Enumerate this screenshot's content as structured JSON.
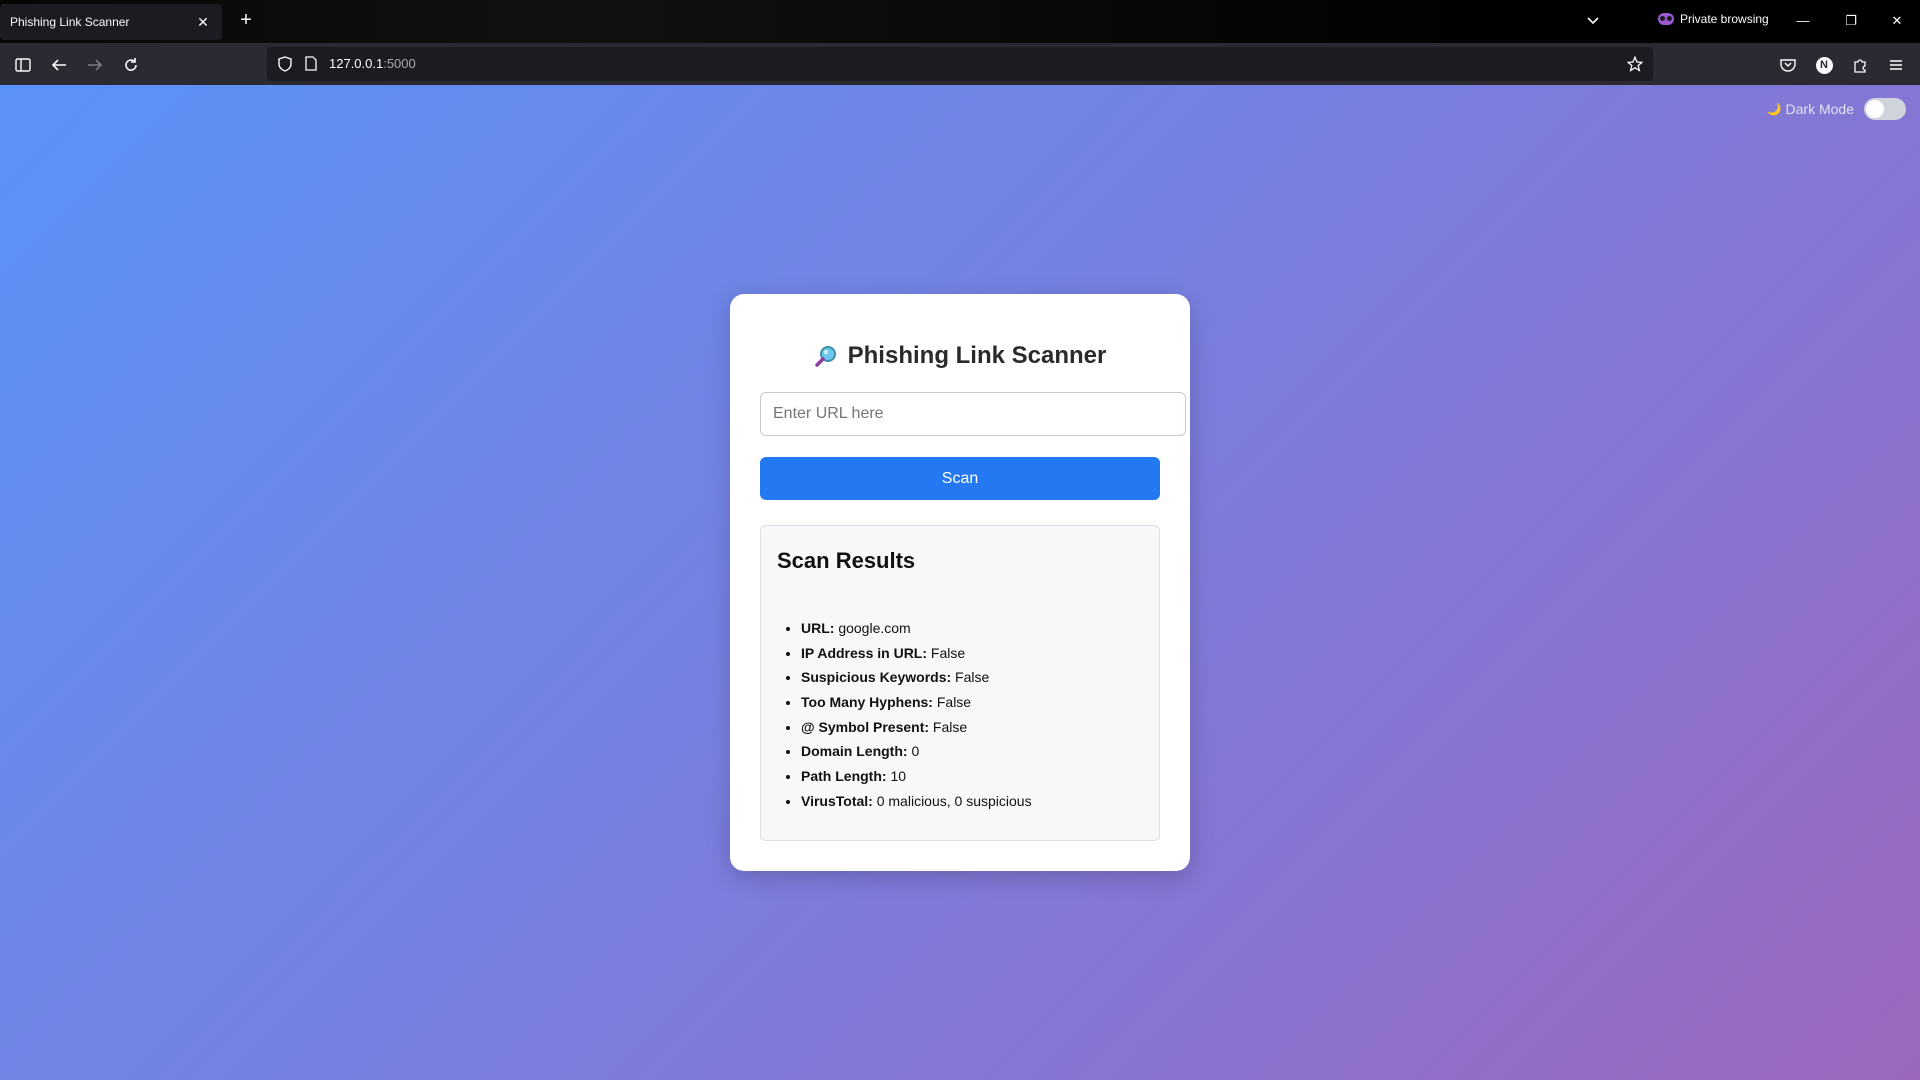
{
  "browser": {
    "tab_title": "Phishing Link Scanner",
    "private_label": "Private browsing",
    "url_host": "127.0.0.1",
    "url_port": ":5000",
    "profile_initial": "N"
  },
  "page": {
    "dark_mode_label": "Dark Mode",
    "dark_mode_on": false,
    "title": "Phishing Link Scanner",
    "input_placeholder": "Enter URL here",
    "input_value": "",
    "scan_label": "Scan",
    "results_title": "Scan Results",
    "results": [
      {
        "label": "URL:",
        "value": "google.com"
      },
      {
        "label": "IP Address in URL:",
        "value": "False"
      },
      {
        "label": "Suspicious Keywords:",
        "value": "False"
      },
      {
        "label": "Too Many Hyphens:",
        "value": "False"
      },
      {
        "label": "@ Symbol Present:",
        "value": "False"
      },
      {
        "label": "Domain Length:",
        "value": "0"
      },
      {
        "label": "Path Length:",
        "value": "10"
      },
      {
        "label": "VirusTotal:",
        "value": "0 malicious, 0 suspicious"
      }
    ]
  },
  "colors": {
    "accent": "#2479f2",
    "gradient_start": "#5b92f8",
    "gradient_end": "#9b67bd"
  }
}
